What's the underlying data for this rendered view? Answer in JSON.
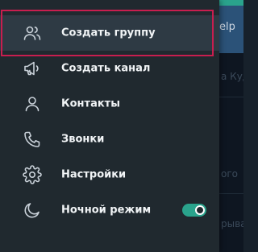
{
  "background": {
    "help_fragment": "elp",
    "text_fragments": [
      "а Куд",
      "ого",
      "рыва"
    ]
  },
  "menu": {
    "items": [
      {
        "label": "Создать группу",
        "icon": "group-icon"
      },
      {
        "label": "Создать канал",
        "icon": "megaphone-icon"
      },
      {
        "label": "Контакты",
        "icon": "person-icon"
      },
      {
        "label": "Звонки",
        "icon": "phone-icon"
      },
      {
        "label": "Настройки",
        "icon": "gear-icon"
      },
      {
        "label": "Ночной режим",
        "icon": "moon-icon"
      }
    ],
    "night_mode_enabled": true
  },
  "colors": {
    "accent": "#2aa38c",
    "highlight": "#c81e4f",
    "drawer_bg": "#20292f"
  }
}
